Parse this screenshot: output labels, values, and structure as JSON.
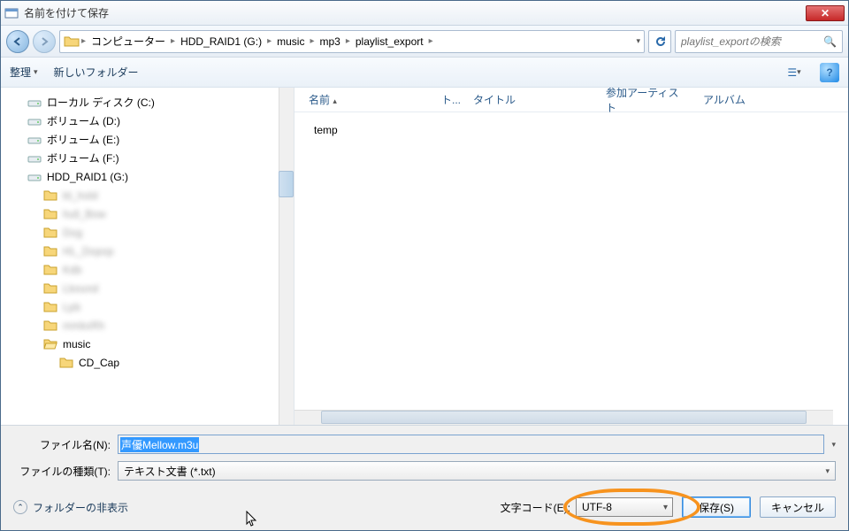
{
  "title": "名前を付けて保存",
  "breadcrumb": [
    "コンピューター",
    "HDD_RAID1 (G:)",
    "music",
    "mp3",
    "playlist_export"
  ],
  "search_placeholder": "playlist_exportの検索",
  "toolbar": {
    "organize": "整理",
    "newfolder": "新しいフォルダー"
  },
  "columns": {
    "name": "名前",
    "track": "ト...",
    "title": "タイトル",
    "artist": "参加アーティスト",
    "album": "アルバム"
  },
  "tree": [
    {
      "label": "ローカル ディスク (C:)",
      "type": "drive",
      "indent": 0
    },
    {
      "label": "ボリューム (D:)",
      "type": "drive",
      "indent": 0
    },
    {
      "label": "ボリューム (E:)",
      "type": "drive",
      "indent": 0
    },
    {
      "label": "ボリューム (F:)",
      "type": "drive",
      "indent": 0
    },
    {
      "label": "HDD_RAID1 (G:)",
      "type": "drive",
      "indent": 0
    },
    {
      "label": "bt_hold",
      "type": "folder",
      "indent": 1,
      "blur": true
    },
    {
      "label": "hull_Bow",
      "type": "folder",
      "indent": 1,
      "blur": true
    },
    {
      "label": "Dog",
      "type": "folder",
      "indent": 1,
      "blur": true
    },
    {
      "label": "HL_Dopop",
      "type": "folder",
      "indent": 1,
      "blur": true
    },
    {
      "label": "Kdb",
      "type": "folder",
      "indent": 1,
      "blur": true
    },
    {
      "label": "Lbound",
      "type": "folder",
      "indent": 1,
      "blur": true
    },
    {
      "label": "Lpb",
      "type": "folder",
      "indent": 1,
      "blur": true
    },
    {
      "label": "mmkxRh",
      "type": "folder",
      "indent": 1,
      "blur": true
    },
    {
      "label": "music",
      "type": "folder-open",
      "indent": 1
    },
    {
      "label": "CD_Cap",
      "type": "folder",
      "indent": 2
    }
  ],
  "files": [
    {
      "name": "temp"
    }
  ],
  "form": {
    "filename_label": "ファイル名(N):",
    "filename_value": "声優Mellow.m3u",
    "type_label": "ファイルの種類(T):",
    "type_value": "テキスト文書 (*.txt)",
    "encoding_label": "文字コード(E):",
    "encoding_value": "UTF-8",
    "hide_folders": "フォルダーの非表示",
    "save": "保存(S)",
    "cancel": "キャンセル"
  }
}
